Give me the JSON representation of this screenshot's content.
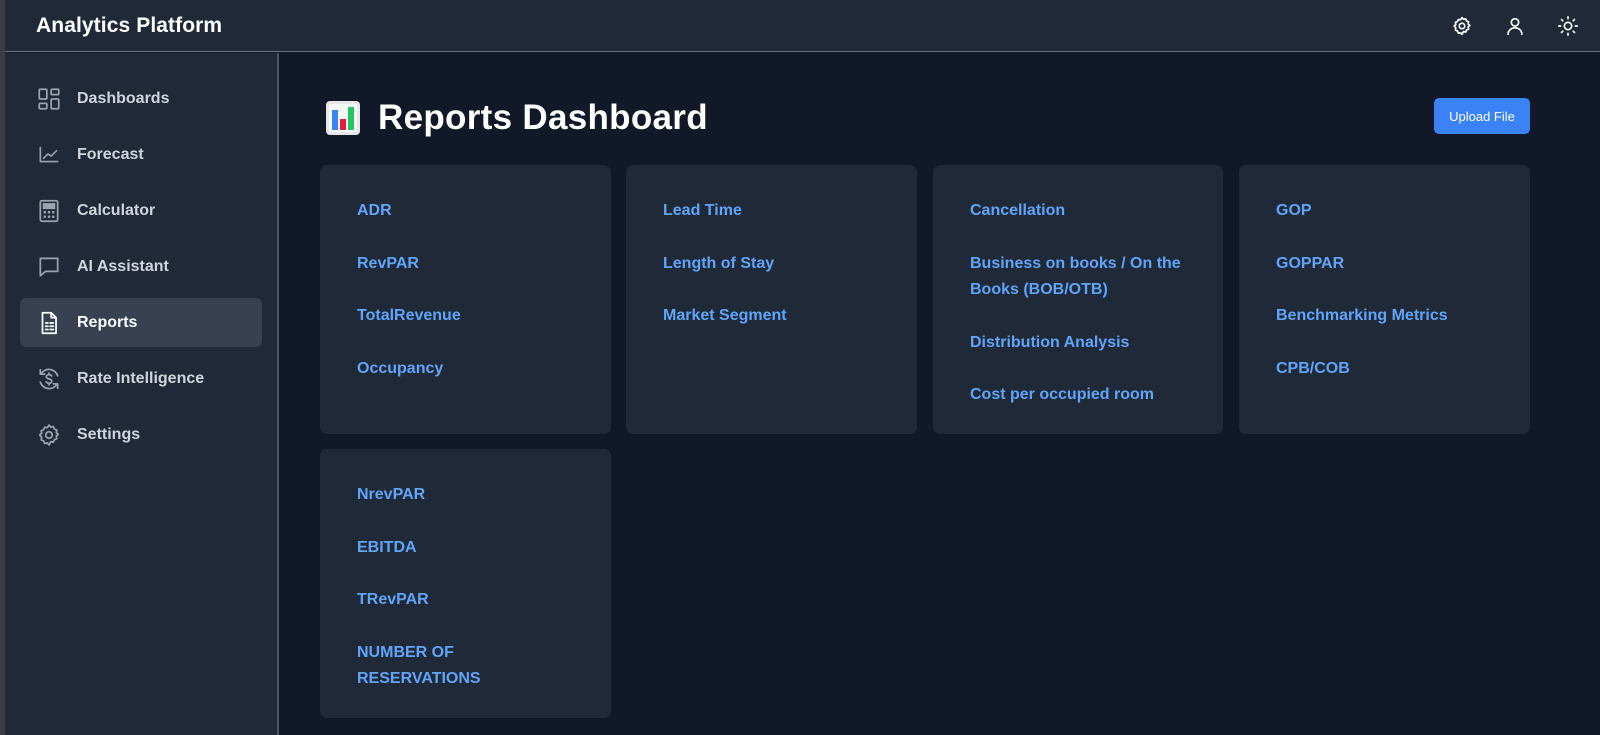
{
  "app": {
    "title": "Analytics Platform"
  },
  "header_icons": [
    "gear-icon",
    "user-icon",
    "sun-icon"
  ],
  "sidebar": {
    "items": [
      {
        "label": "Dashboards",
        "icon": "dashboard-grid-icon",
        "active": false
      },
      {
        "label": "Forecast",
        "icon": "line-chart-icon",
        "active": false
      },
      {
        "label": "Calculator",
        "icon": "calculator-icon",
        "active": false
      },
      {
        "label": "AI Assistant",
        "icon": "chat-bubble-icon",
        "active": false
      },
      {
        "label": "Reports",
        "icon": "report-document-icon",
        "active": true
      },
      {
        "label": "Rate Intelligence",
        "icon": "dollar-refresh-icon",
        "active": false
      },
      {
        "label": "Settings",
        "icon": "gear-icon",
        "active": false
      }
    ]
  },
  "main": {
    "title": "Reports Dashboard",
    "title_icon": "bar-chart-emoji",
    "upload_label": "Upload File",
    "cards": [
      {
        "links": [
          "ADR",
          "RevPAR",
          "TotalRevenue",
          "Occupancy"
        ]
      },
      {
        "links": [
          "Lead Time",
          "Length of Stay",
          "Market Segment"
        ]
      },
      {
        "links": [
          "Cancellation",
          "Business on books / On the Books (BOB/OTB)",
          "Distribution Analysis",
          "Cost per occupied room"
        ]
      },
      {
        "links": [
          "GOP",
          "GOPPAR",
          "Benchmarking Metrics",
          "CPB/COB"
        ]
      },
      {
        "links": [
          "NrevPAR",
          "EBITDA",
          "TRevPAR",
          "NUMBER OF RESERVATIONS"
        ]
      }
    ]
  },
  "colors": {
    "background": "#111827",
    "panel": "#1f2937",
    "active_nav": "#374151",
    "link": "#60a5fa",
    "accent": "#3b82f6"
  }
}
